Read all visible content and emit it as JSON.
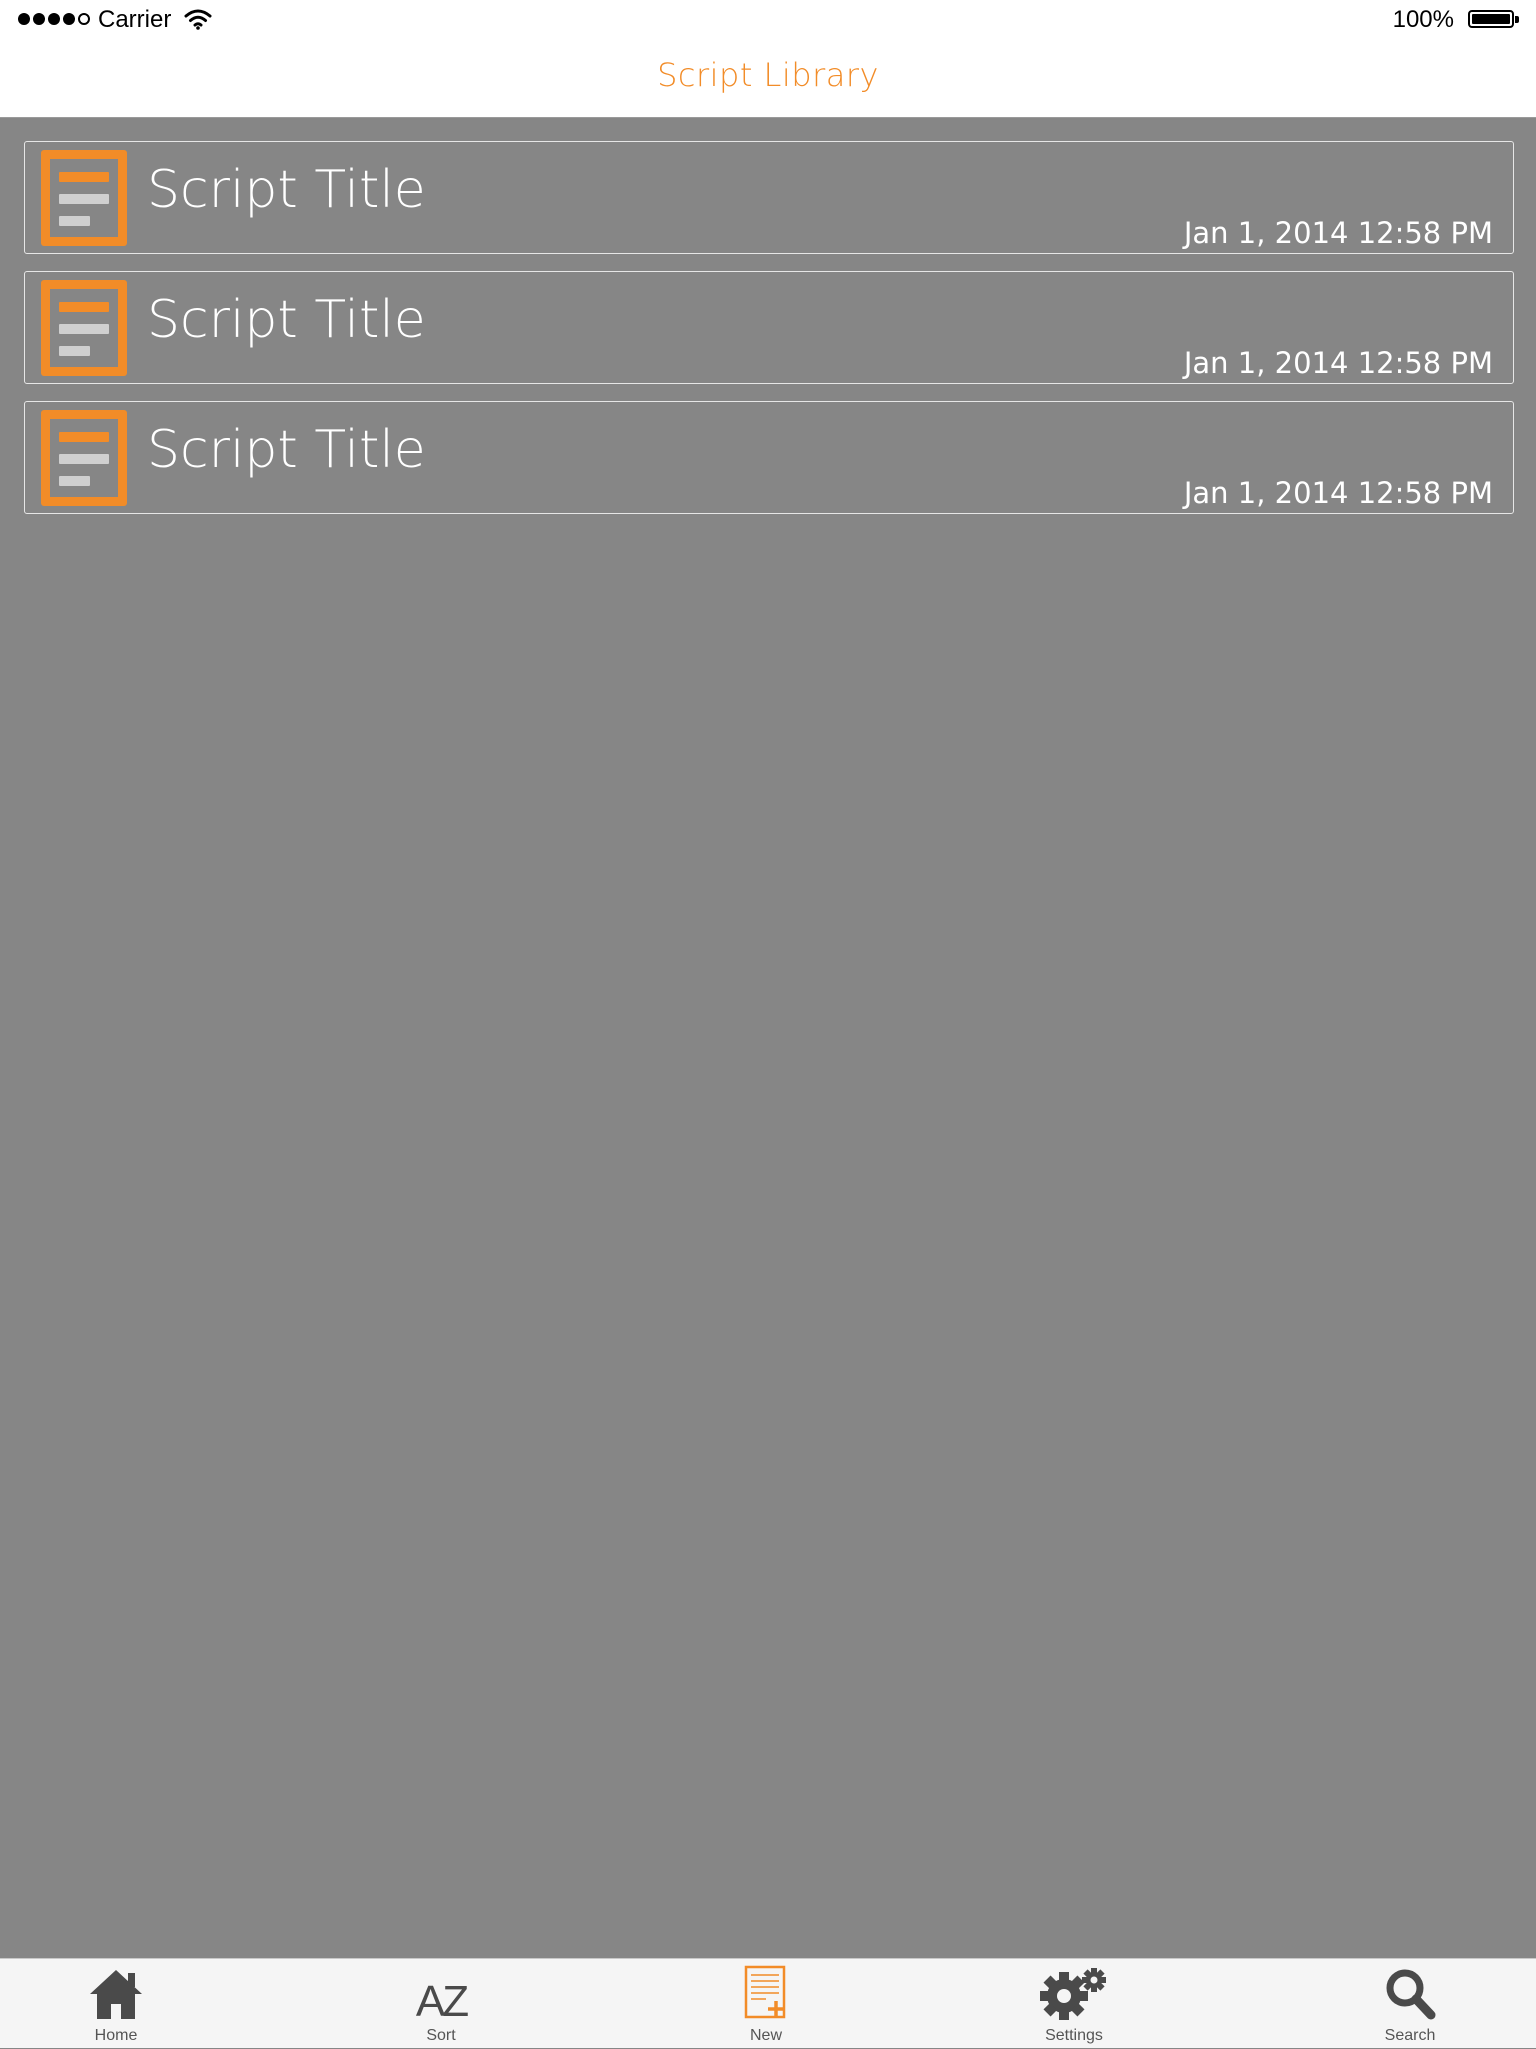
{
  "status_bar": {
    "carrier": "Carrier",
    "battery": "100%"
  },
  "nav": {
    "title": "Script Library"
  },
  "colors": {
    "accent": "#f28c28",
    "background": "#868686",
    "tabbar": "#f5f5f5"
  },
  "scripts": [
    {
      "title": "Script Title",
      "date": "Jan 1, 2014 12:58 PM",
      "icon": "document-icon"
    },
    {
      "title": "Script Title",
      "date": "Jan 1, 2014 12:58 PM",
      "icon": "document-icon"
    },
    {
      "title": "Script Title",
      "date": "Jan 1, 2014 12:58 PM",
      "icon": "document-icon"
    }
  ],
  "tabs": [
    {
      "label": "Home",
      "icon": "home-icon"
    },
    {
      "label": "Sort",
      "icon": "az-sort-icon",
      "glyph": "AZ"
    },
    {
      "label": "New",
      "icon": "new-document-icon"
    },
    {
      "label": "Settings",
      "icon": "gears-icon"
    },
    {
      "label": "Search",
      "icon": "search-icon"
    }
  ]
}
